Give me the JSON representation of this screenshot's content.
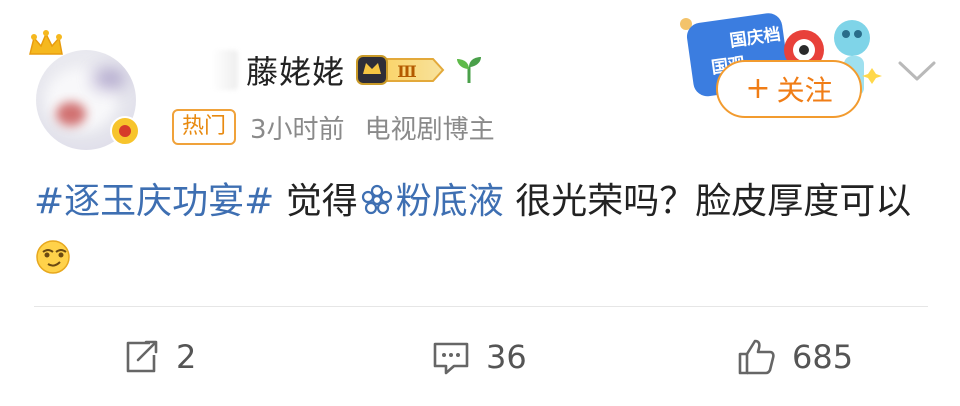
{
  "post": {
    "author": {
      "name_visible": "藤姥姥",
      "level_badge": "Ⅲ",
      "avatar": "blurred-avatar",
      "crown": "crown-icon"
    },
    "meta": {
      "tag": "热门",
      "time": "3小时前",
      "source": "电视剧博主"
    },
    "follow_label": "关注",
    "follow_prefix": "+",
    "promo_badge_text": "国庆档 国观",
    "content": {
      "topic": "#逐玉庆功宴#",
      "text1": " 觉得",
      "link": "粉底液",
      "text2": " 很光荣吗？脸皮厚度可以"
    },
    "actions": {
      "repost_count": "2",
      "comment_count": "36",
      "like_count": "685"
    }
  },
  "colors": {
    "accent": "#f07d16",
    "topic": "#3e6fb2",
    "meta": "#8a8a8a"
  }
}
